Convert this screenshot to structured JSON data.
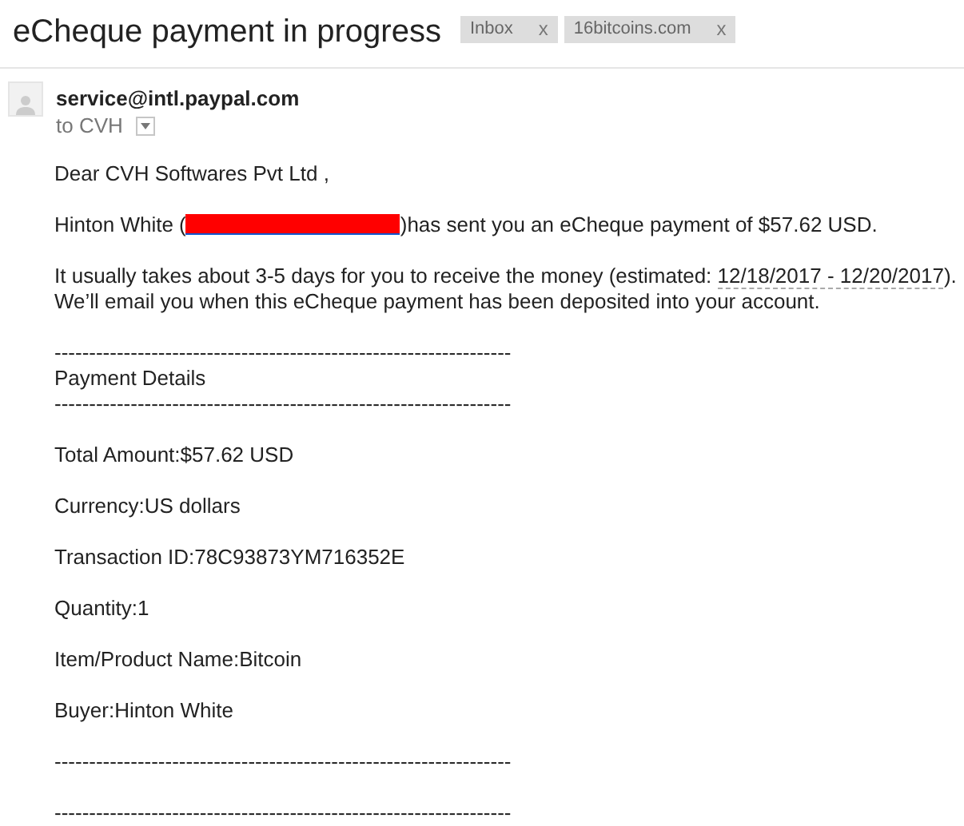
{
  "subject": "eCheque payment in progress",
  "labels": [
    {
      "name": "Inbox",
      "remove": "x"
    },
    {
      "name": "16bitcoins.com",
      "remove": "x"
    }
  ],
  "sender": "service@intl.paypal.com",
  "recipient": "to CVH",
  "body": {
    "greeting": "Dear CVH Softwares Pvt Ltd ,",
    "sent_before": "Hinton White (",
    "sent_after": ")has sent you an eCheque payment of $57.62 USD.",
    "estimate_before": "It usually takes about 3-5 days for you to receive the money (estimated: ",
    "estimate_dates": "12/18/2017 - 12/20/2017",
    "estimate_after": ").",
    "notice": "We’ll email you when this eCheque payment has been deposited into your account.",
    "lines": [
      {
        "kind": "rule",
        "text": "------------------------------------------------------------------"
      },
      {
        "kind": "text",
        "text": "Payment Details"
      },
      {
        "kind": "rule",
        "text": "------------------------------------------------------------------"
      },
      {
        "kind": "gap"
      },
      {
        "kind": "text",
        "text": "Total Amount:$57.62 USD"
      },
      {
        "kind": "gap"
      },
      {
        "kind": "text",
        "text": "Currency:US dollars"
      },
      {
        "kind": "gap"
      },
      {
        "kind": "text",
        "text": "Transaction ID:78C93873YM716352E"
      },
      {
        "kind": "gap"
      },
      {
        "kind": "text",
        "text": "Quantity:1"
      },
      {
        "kind": "gap"
      },
      {
        "kind": "text",
        "text": "Item/Product Name:Bitcoin"
      },
      {
        "kind": "gap"
      },
      {
        "kind": "text",
        "text": "Buyer:Hinton White"
      },
      {
        "kind": "gap"
      },
      {
        "kind": "rule",
        "text": "------------------------------------------------------------------"
      },
      {
        "kind": "gap"
      },
      {
        "kind": "rule",
        "text": "------------------------------------------------------------------"
      }
    ]
  }
}
